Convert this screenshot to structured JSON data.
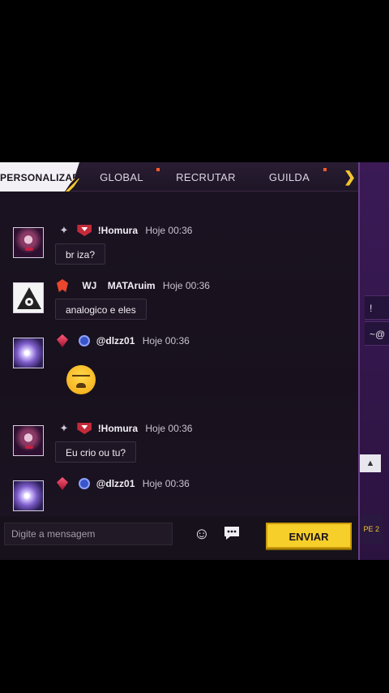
{
  "tabs": {
    "active": "PERSONALIZADA",
    "global": "GLOBAL",
    "recrutar": "RECRUTAR",
    "guilda": "GUILDA",
    "more_icon": "chevron-right-icon"
  },
  "messages": [
    {
      "user": "!Homura",
      "time": "Hoje 00:36",
      "text": "br iza?"
    },
    {
      "tag": "WJ",
      "user": "MATAruim",
      "time": "Hoje 00:36",
      "text": "analogico e eles"
    },
    {
      "user": "@dlzz01",
      "time": "Hoje 00:36",
      "emoji": "crying-emoji"
    },
    {
      "user": "!Homura",
      "time": "Hoje 00:36",
      "text": "Eu crio ou tu?"
    },
    {
      "user": "@dlzz01",
      "time": "Hoje 00:36"
    }
  ],
  "input": {
    "placeholder": "Digite a mensagem",
    "emoji_icon": "smiley-icon",
    "quick_chat_icon": "chat-bubble-icon",
    "send_label": "ENVIAR"
  },
  "side_panel": {
    "row1": "!",
    "row2": "~@",
    "tag": "PE 2"
  },
  "colors": {
    "accent": "#f6cf2b",
    "background": "#18111d",
    "notify": "#ff5a2a"
  }
}
